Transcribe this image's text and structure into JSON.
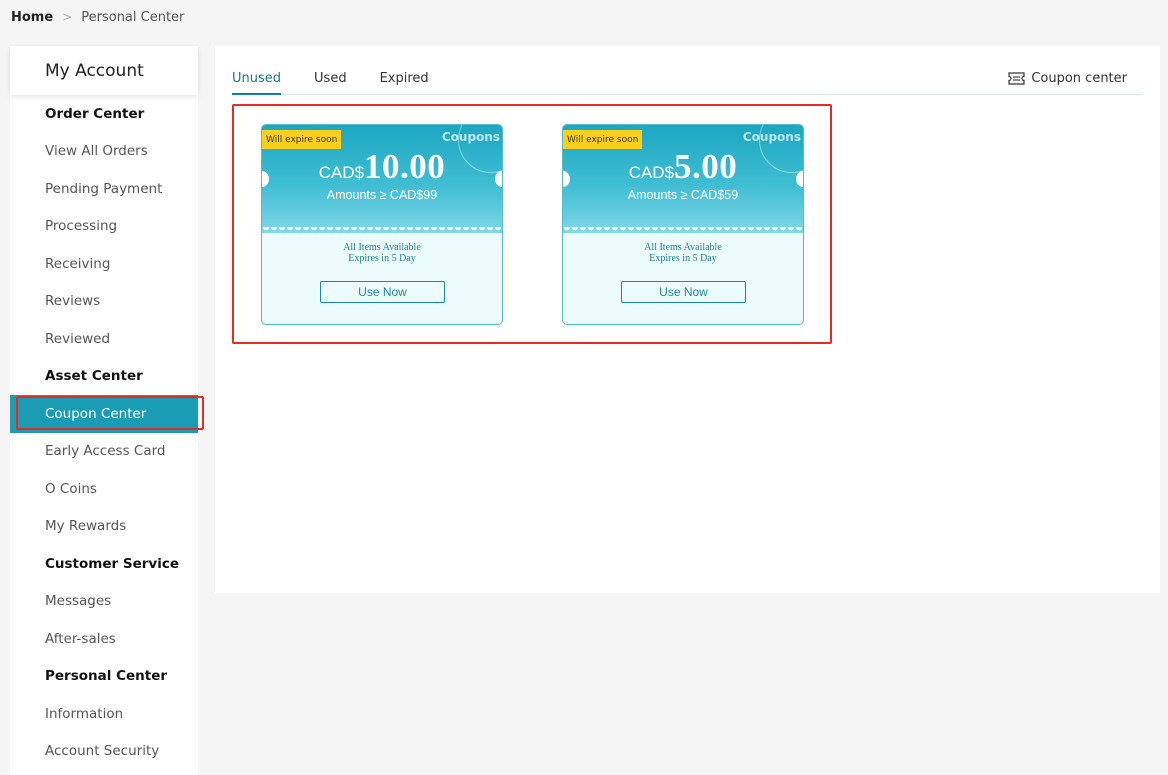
{
  "breadcrumb": {
    "home": "Home",
    "current": "Personal Center"
  },
  "sidebar": {
    "title": "My Account",
    "sections": [
      {
        "title": "Order Center",
        "items": [
          "View All Orders",
          "Pending Payment",
          "Processing",
          "Receiving",
          "Reviews",
          "Reviewed"
        ]
      },
      {
        "title": "Asset Center",
        "items": [
          "Coupon Center",
          "Early Access Card",
          "O Coins",
          "My Rewards"
        ]
      },
      {
        "title": "Customer Service",
        "items": [
          "Messages",
          "After-sales"
        ]
      },
      {
        "title": "Personal Center",
        "items": [
          "Information",
          "Account Security"
        ]
      }
    ],
    "active_item": "Coupon Center"
  },
  "tabs": [
    {
      "label": "Unused",
      "active": true
    },
    {
      "label": "Used",
      "active": false
    },
    {
      "label": "Expired",
      "active": false
    }
  ],
  "coupon_center_link": "Coupon center",
  "coupons": [
    {
      "tag": "Will expire soon",
      "stamp": "Coupons",
      "currency": "CAD$",
      "amount": "10.00",
      "condition": "Amounts ≥ CAD$99",
      "scope": "All Items Available",
      "expiry": "Expires in 5 Day",
      "button": "Use Now"
    },
    {
      "tag": "Will expire soon",
      "stamp": "Coupons",
      "currency": "CAD$",
      "amount": "5.00",
      "condition": "Amounts ≥ CAD$59",
      "scope": "All Items Available",
      "expiry": "Expires in 5 Day",
      "button": "Use Now"
    }
  ],
  "colors": {
    "accent": "#1a9cb5",
    "tab_active": "#127e98",
    "tag": "#fccf1c",
    "highlight": "#e02d24"
  }
}
